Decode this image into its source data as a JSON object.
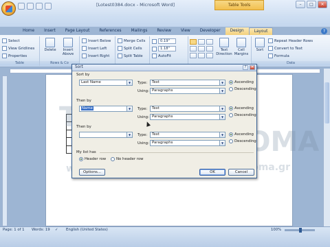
{
  "app": {
    "title": "[Lotest0384.docx - Microsoft Word]",
    "context_tab_group": "Table Tools",
    "window_controls": [
      "–",
      "□",
      "✕"
    ]
  },
  "tabs": [
    {
      "label": "Home"
    },
    {
      "label": "Insert"
    },
    {
      "label": "Page Layout"
    },
    {
      "label": "References"
    },
    {
      "label": "Mailings"
    },
    {
      "label": "Review"
    },
    {
      "label": "View"
    },
    {
      "label": "Developer"
    },
    {
      "label": "Design"
    },
    {
      "label": "Layout"
    }
  ],
  "ribbon": {
    "table_group": {
      "select": "Select",
      "gridlines": "View Gridlines",
      "properties": "Properties",
      "label": "Table"
    },
    "rows_cols_group": {
      "delete": "Delete",
      "insert_above": "Insert Above",
      "insert_below": "Insert Below",
      "insert_left": "Insert Left",
      "insert_right": "Insert Right",
      "label": "Rows & Co"
    },
    "merge_group": {
      "merge_cells": "Merge Cells",
      "split_cells": "Split Cells",
      "split_table": "Split Table"
    },
    "cell_size_group": {
      "height": "0.19\"",
      "width": "1.18\"",
      "autofit": "AutoFit"
    },
    "alignment_group": {
      "text_direction": "Text Direction",
      "cell_margins": "Cell Margins"
    },
    "data_group": {
      "sort": "Sort",
      "repeat_header": "Repeat Header Rows",
      "convert": "Convert to Text",
      "formula": "Formula",
      "label": "Data"
    }
  },
  "status": {
    "page": "Page: 1 of 1",
    "words": "Words: 19",
    "language": "English (United States)",
    "zoom": "100%"
  },
  "watermark": {
    "left_test": "TEST",
    "left_4u": "4U",
    "right_diploma": "DIPLOMA",
    "url_left": "www.test4u.eu",
    "url_right": "www.testdiploma.gr"
  },
  "dialog": {
    "title": "Sort",
    "sort_by": {
      "label": "Sort by",
      "field": "Last Name",
      "type_label": "Type:",
      "type": "Text",
      "using_label": "Using:",
      "using": "Paragraphs",
      "ascending": "Ascending",
      "descending": "Descending",
      "selected": "ascending"
    },
    "then_by_1": {
      "label": "Then by",
      "field": "Name",
      "type_label": "Type:",
      "type": "Text",
      "using_label": "Using:",
      "using": "Paragraphs",
      "ascending": "Ascending",
      "descending": "Descending",
      "selected": "ascending"
    },
    "then_by_2": {
      "label": "Then by",
      "field": "",
      "type_label": "Type:",
      "type": "Text",
      "using_label": "Using:",
      "using": "Paragraphs",
      "ascending": "Ascending",
      "descending": "Descending",
      "selected": "ascending"
    },
    "my_list_has": {
      "label": "My list has",
      "header_row": "Header row",
      "no_header_row": "No header row",
      "selected": "header_row"
    },
    "buttons": {
      "options": "Options...",
      "ok": "OK",
      "cancel": "Cancel"
    }
  }
}
